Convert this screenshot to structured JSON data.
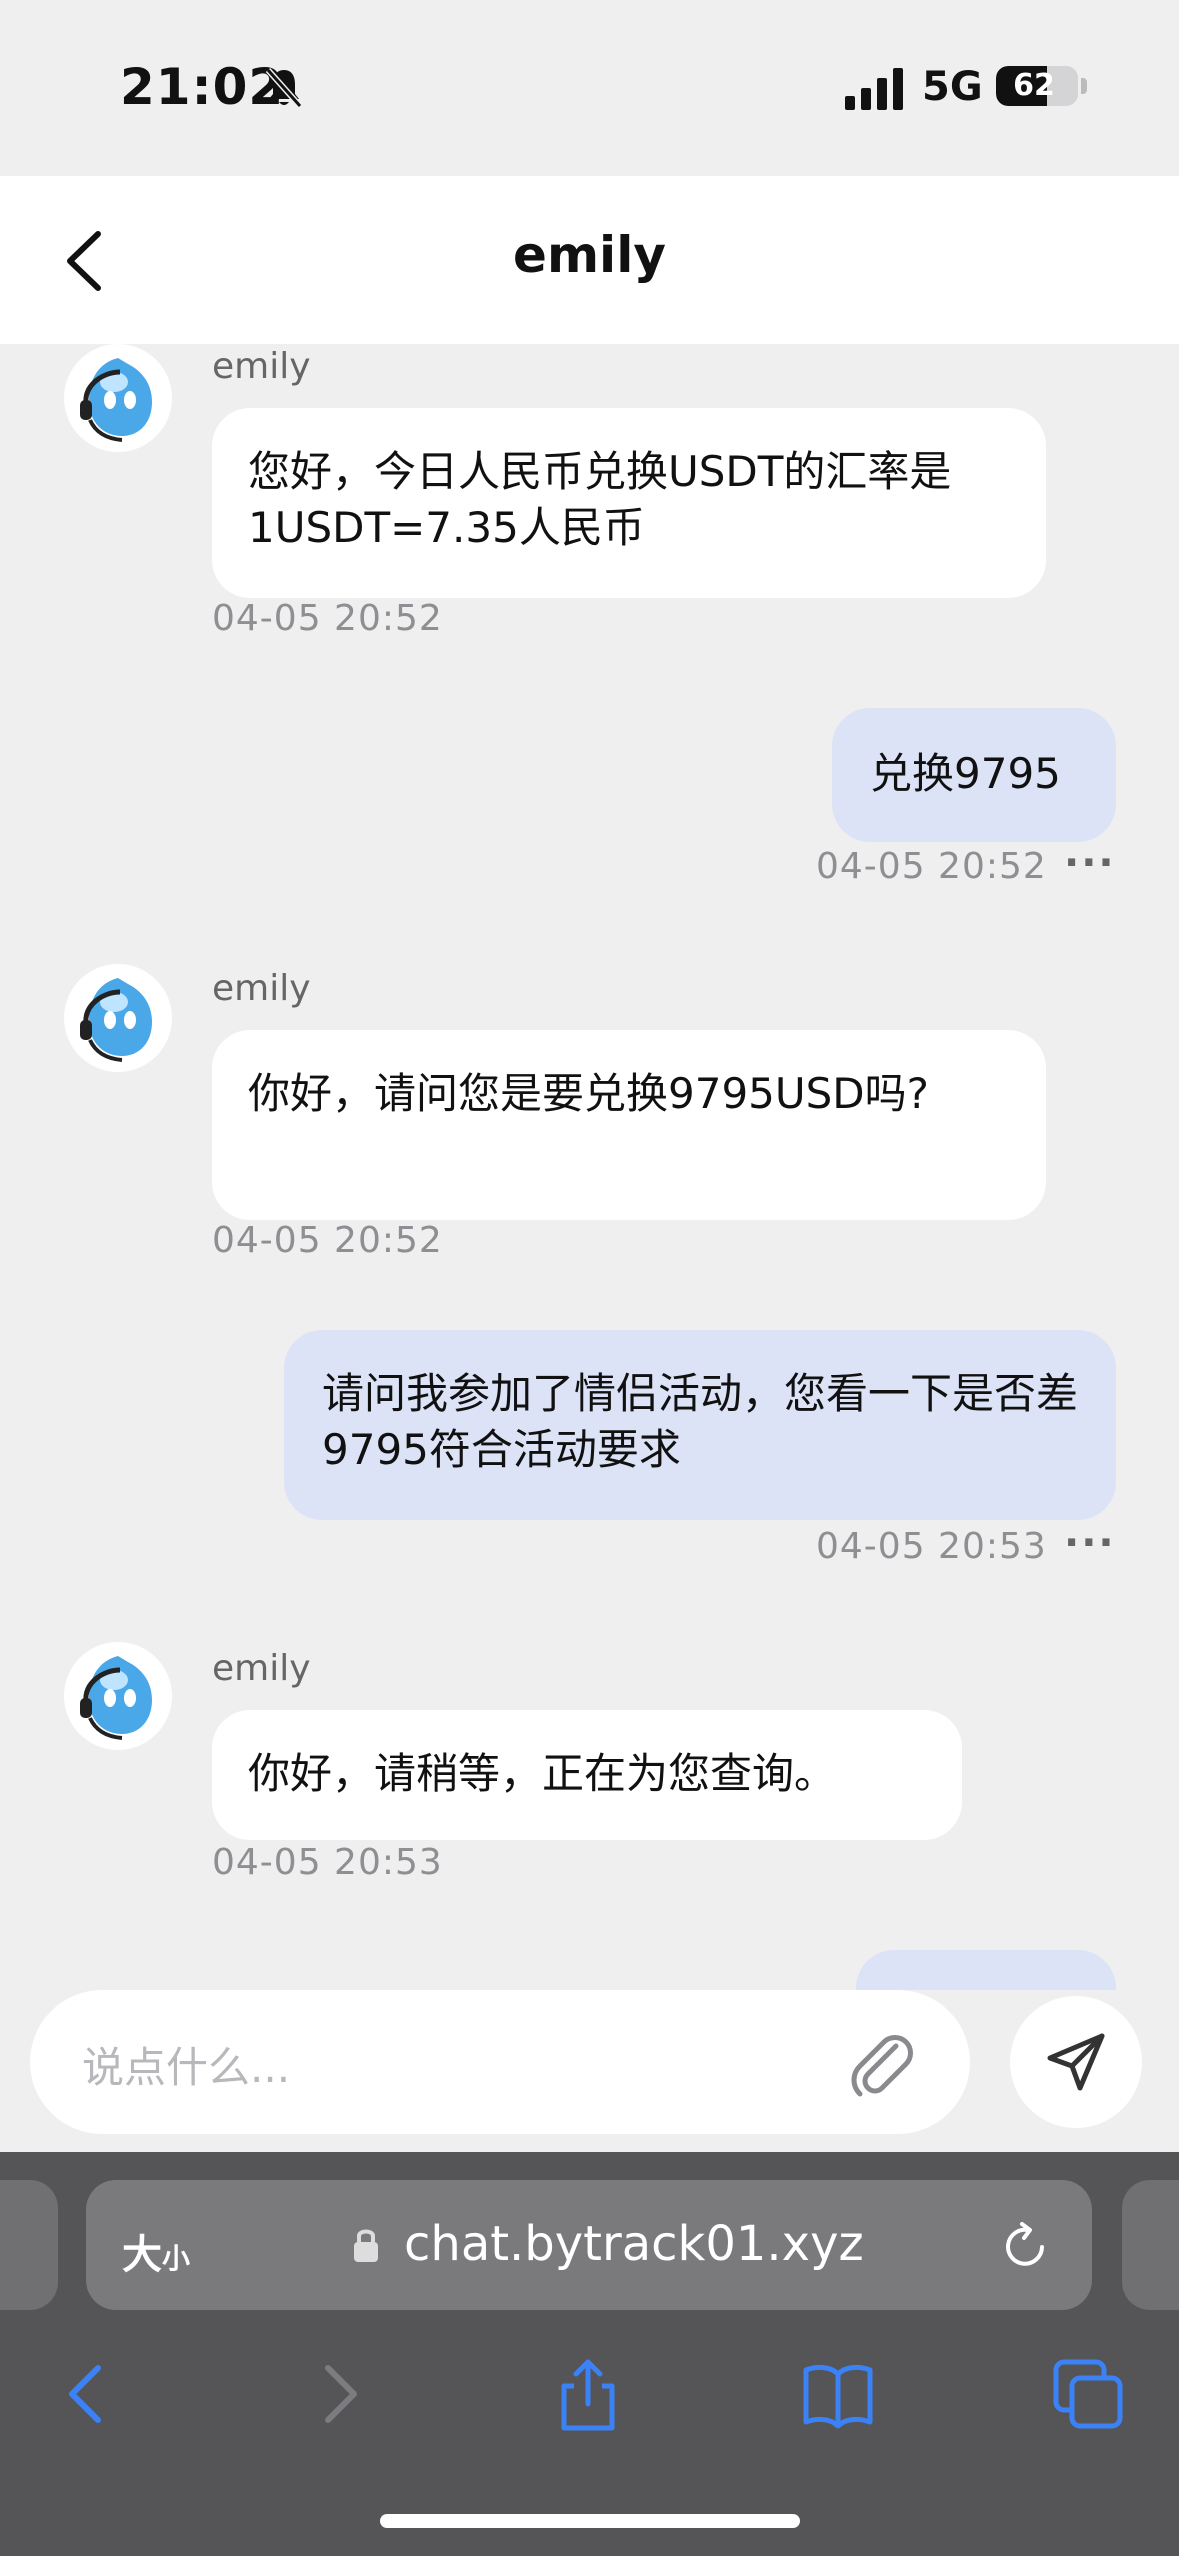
{
  "status_bar": {
    "time": "21:02",
    "network": "5G",
    "battery_level": "62",
    "battery_fraction": 0.62
  },
  "header": {
    "title": "emily"
  },
  "messages": [
    {
      "sender": "emily",
      "text": "您好，今日人民币兑换USDT的汇率是1USDT=7.35人民币",
      "time": "04-05 20:52"
    },
    {
      "text": "兑换9795",
      "time": "04-05 20:52",
      "more": "···"
    },
    {
      "sender": "emily",
      "text": "你好，请问您是要兑换9795USD吗?",
      "time": "04-05 20:52"
    },
    {
      "text": "请问我参加了情侣活动，您看一下是否差9795符合活动要求",
      "time": "04-05 20:53",
      "more": "···"
    },
    {
      "sender": "emily",
      "text": "你好，请稍等，正在为您查询。",
      "time": "04-05 20:53"
    }
  ],
  "composer": {
    "placeholder": "说点什么..."
  },
  "browser": {
    "text_size_big": "大",
    "text_size_small": "小",
    "url": "chat.bytrack01.xyz"
  },
  "colors": {
    "outgoing_bubble": "#dce3f7",
    "incoming_bubble": "#ffffff",
    "background": "#efeff0",
    "browser_accent": "#3b82f6"
  },
  "icons": [
    "bell-slash-icon",
    "signal-icon",
    "battery-icon",
    "back-icon",
    "avatar-icon",
    "paperclip-icon",
    "send-icon",
    "lock-icon",
    "reload-icon",
    "browser-back-icon",
    "browser-forward-icon",
    "share-icon",
    "bookmarks-icon",
    "tabs-icon"
  ]
}
